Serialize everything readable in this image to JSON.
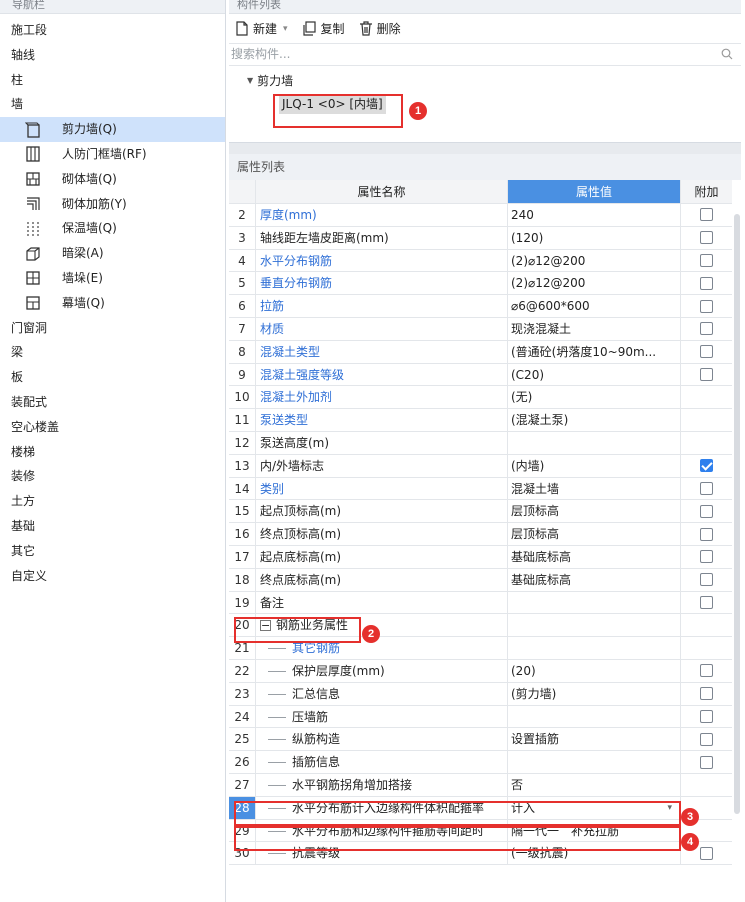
{
  "nav": {
    "title": "导航栏",
    "items": [
      {
        "label": "施工段",
        "level": 0
      },
      {
        "label": "轴线",
        "level": 0
      },
      {
        "label": "柱",
        "level": 0
      },
      {
        "label": "墙",
        "level": 0
      },
      {
        "label": "剪力墙(Q)",
        "level": 1,
        "icon": "shear-wall-icon",
        "selected": true
      },
      {
        "label": "人防门框墙(RF)",
        "level": 1,
        "icon": "civil-defense-door-wall-icon"
      },
      {
        "label": "砌体墙(Q)",
        "level": 1,
        "icon": "masonry-wall-icon"
      },
      {
        "label": "砌体加筋(Y)",
        "level": 1,
        "icon": "masonry-reinforcement-icon"
      },
      {
        "label": "保温墙(Q)",
        "level": 1,
        "icon": "insulation-wall-icon"
      },
      {
        "label": "暗梁(A)",
        "level": 1,
        "icon": "concealed-beam-icon"
      },
      {
        "label": "墙垛(E)",
        "level": 1,
        "icon": "wall-pier-icon"
      },
      {
        "label": "幕墙(Q)",
        "level": 1,
        "icon": "curtain-wall-icon"
      },
      {
        "label": "门窗洞",
        "level": 0
      },
      {
        "label": "梁",
        "level": 0
      },
      {
        "label": "板",
        "level": 0
      },
      {
        "label": "装配式",
        "level": 0
      },
      {
        "label": "空心楼盖",
        "level": 0
      },
      {
        "label": "楼梯",
        "level": 0
      },
      {
        "label": "装修",
        "level": 0
      },
      {
        "label": "土方",
        "level": 0
      },
      {
        "label": "基础",
        "level": 0
      },
      {
        "label": "其它",
        "level": 0
      },
      {
        "label": "自定义",
        "level": 0
      }
    ]
  },
  "component_list": {
    "title": "构件列表",
    "toolbar": {
      "new_label": "新建",
      "copy_label": "复制",
      "delete_label": "删除"
    },
    "search_placeholder": "搜索构件...",
    "tree_parent": "剪力墙",
    "tree_child": "JLQ-1 <0> [内墙]"
  },
  "badges": [
    "1",
    "2",
    "3",
    "4"
  ],
  "properties": {
    "title": "属性列表",
    "headers": {
      "name": "属性名称",
      "value": "属性值",
      "extra": "附加"
    },
    "rows": [
      {
        "num": "2",
        "name": "厚度(mm)",
        "value": "240",
        "blue": true,
        "check": false
      },
      {
        "num": "3",
        "name": "轴线距左墙皮距离(mm)",
        "value": "(120)",
        "check": false
      },
      {
        "num": "4",
        "name": "水平分布钢筋",
        "value": "(2)⌀12@200",
        "blue": true,
        "check": false
      },
      {
        "num": "5",
        "name": "垂直分布钢筋",
        "value": "(2)⌀12@200",
        "blue": true,
        "check": false
      },
      {
        "num": "6",
        "name": "拉筋",
        "value": "⌀6@600*600",
        "blue": true,
        "check": false
      },
      {
        "num": "7",
        "name": "材质",
        "value": "现浇混凝土",
        "blue": true,
        "check": false
      },
      {
        "num": "8",
        "name": "混凝土类型",
        "value": "(普通砼(坍落度10~90m...",
        "blue": true,
        "check": false
      },
      {
        "num": "9",
        "name": "混凝土强度等级",
        "value": "(C20)",
        "blue": true,
        "check": false
      },
      {
        "num": "10",
        "name": "混凝土外加剂",
        "value": "(无)",
        "blue": true
      },
      {
        "num": "11",
        "name": "泵送类型",
        "value": "(混凝土泵)",
        "blue": true
      },
      {
        "num": "12",
        "name": "泵送高度(m)",
        "value": ""
      },
      {
        "num": "13",
        "name": "内/外墙标志",
        "value": "(内墙)",
        "check": true
      },
      {
        "num": "14",
        "name": "类别",
        "value": "混凝土墙",
        "blue": true,
        "check": false
      },
      {
        "num": "15",
        "name": "起点顶标高(m)",
        "value": "层顶标高",
        "check": false
      },
      {
        "num": "16",
        "name": "终点顶标高(m)",
        "value": "层顶标高",
        "check": false
      },
      {
        "num": "17",
        "name": "起点底标高(m)",
        "value": "基础底标高",
        "check": false
      },
      {
        "num": "18",
        "name": "终点底标高(m)",
        "value": "基础底标高",
        "check": false
      },
      {
        "num": "19",
        "name": "备注",
        "value": "",
        "check": false
      },
      {
        "num": "20",
        "name": "钢筋业务属性",
        "value": "",
        "group": true
      },
      {
        "num": "21",
        "name": "其它钢筋",
        "value": "",
        "child": true,
        "blue": true
      },
      {
        "num": "22",
        "name": "保护层厚度(mm)",
        "value": "(20)",
        "child": true,
        "check": false
      },
      {
        "num": "23",
        "name": "汇总信息",
        "value": "(剪力墙)",
        "child": true,
        "check": false
      },
      {
        "num": "24",
        "name": "压墙筋",
        "value": "",
        "child": true,
        "check": false
      },
      {
        "num": "25",
        "name": "纵筋构造",
        "value": "设置插筋",
        "child": true,
        "check": false
      },
      {
        "num": "26",
        "name": "插筋信息",
        "value": "",
        "child": true,
        "check": false
      },
      {
        "num": "27",
        "name": "水平钢筋拐角增加搭接",
        "value": "否",
        "child": true
      },
      {
        "num": "28",
        "name": "水平分布筋计入边缘构件体积配箍率",
        "value": "计入",
        "child": true,
        "selected": true,
        "dropdown": true
      },
      {
        "num": "29",
        "name": "水平分布筋和边缘构件箍筋等间距时",
        "value": "隔一代一",
        "child": true,
        "note": "补充拉筋"
      },
      {
        "num": "30",
        "name": "抗震等级",
        "value": "(一级抗震)",
        "child": true,
        "check": false
      }
    ]
  }
}
